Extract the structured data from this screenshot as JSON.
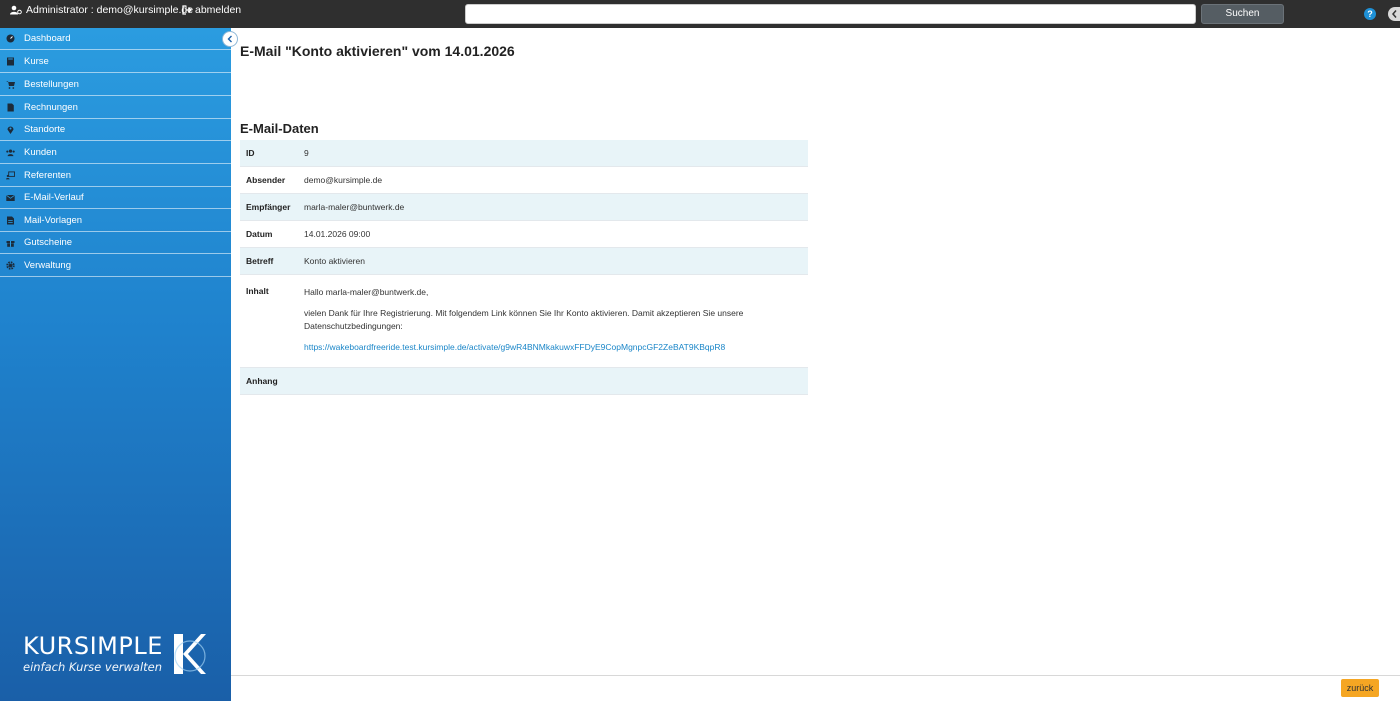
{
  "topbar": {
    "user_label": "Administrator : demo@kursimple.de",
    "logout_label": "abmelden",
    "search_placeholder": "",
    "search_button": "Suchen",
    "help_glyph": "?"
  },
  "sidebar": {
    "items": [
      {
        "label": "Dashboard",
        "icon": "dashboard-icon"
      },
      {
        "label": "Kurse",
        "icon": "book-icon"
      },
      {
        "label": "Bestellungen",
        "icon": "cart-icon"
      },
      {
        "label": "Rechnungen",
        "icon": "document-icon"
      },
      {
        "label": "Standorte",
        "icon": "map-pin-icon"
      },
      {
        "label": "Kunden",
        "icon": "users-icon"
      },
      {
        "label": "Referenten",
        "icon": "presenter-icon"
      },
      {
        "label": "E-Mail-Verlauf",
        "icon": "envelope-icon"
      },
      {
        "label": "Mail-Vorlagen",
        "icon": "template-icon"
      },
      {
        "label": "Gutscheine",
        "icon": "gift-icon"
      },
      {
        "label": "Verwaltung",
        "icon": "gear-icon"
      }
    ],
    "logo": {
      "brand": "KURSIMPLE",
      "tagline": "einfach Kurse verwalten"
    }
  },
  "main": {
    "title": "E-Mail \"Konto aktivieren\" vom 14.01.2026",
    "section_title": "E-Mail-Daten",
    "fields": {
      "id": {
        "label": "ID",
        "value": "9"
      },
      "sender": {
        "label": "Absender",
        "value": "demo@kursimple.de"
      },
      "recipient": {
        "label": "Empfänger",
        "value": "marla-maler@buntwerk.de"
      },
      "date": {
        "label": "Datum",
        "value": "14.01.2026 09:00"
      },
      "subject": {
        "label": "Betreff",
        "value": "Konto aktivieren"
      },
      "content": {
        "label": "Inhalt",
        "greeting": "Hallo marla-maler@buntwerk.de,",
        "body": "vielen Dank für Ihre Registrierung. Mit folgendem Link können Sie Ihr Konto aktivieren. Damit akzeptieren Sie unsere Datenschutzbedingungen:",
        "link": "https://wakeboardfreeride.test.kursimple.de/activate/g9wR4BNMkakuwxFFDyE9CopMgnpcGF2ZeBAT9KBqpR8"
      },
      "attachment": {
        "label": "Anhang",
        "value": ""
      }
    }
  },
  "footer": {
    "back_button": "zurück"
  },
  "colors": {
    "sidebar_top": "#2b9ce0",
    "sidebar_bottom": "#1a5fa8",
    "topbar": "#2f2f2f",
    "row_shade": "#e8f4f8",
    "accent_button": "#f5a623",
    "link": "#1a86c8"
  }
}
